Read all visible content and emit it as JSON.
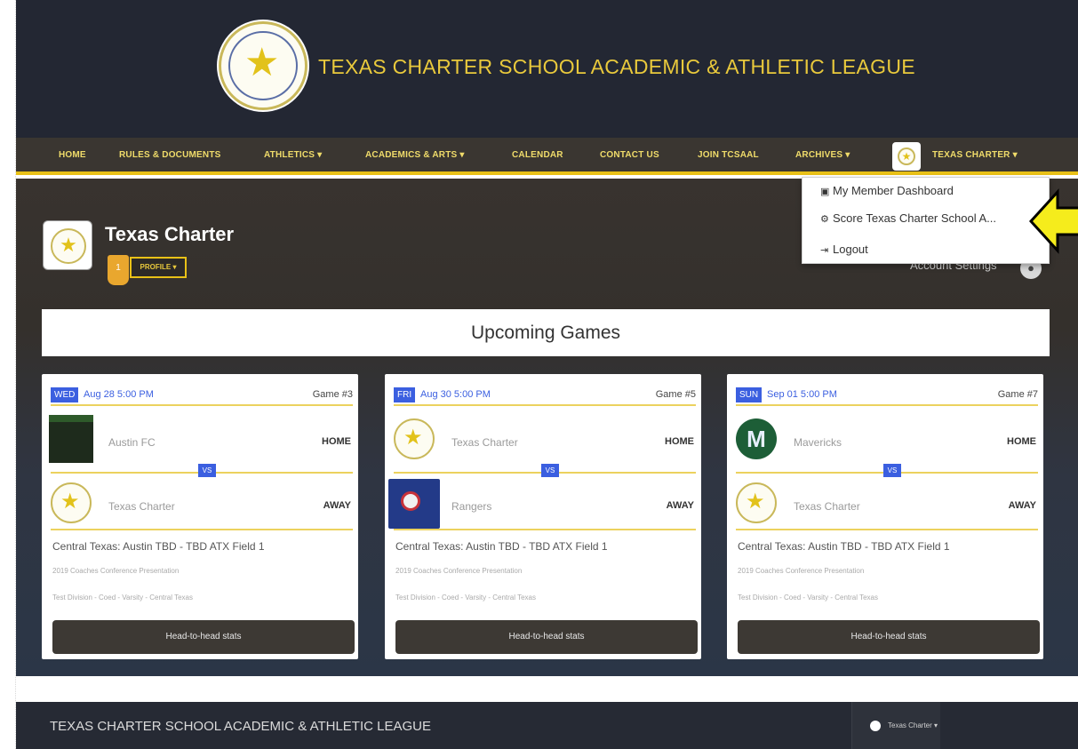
{
  "site": {
    "title": "TEXAS CHARTER SCHOOL ACADEMIC & ATHLETIC LEAGUE"
  },
  "nav": {
    "home": "HOME",
    "rules": "RULES & DOCUMENTS",
    "athletics": "ATHLETICS ▾",
    "academics": "ACADEMICS & ARTS ▾",
    "calendar": "CALENDAR",
    "contact": "CONTACT US",
    "join": "JOIN TCSAAL",
    "archives": "ARCHIVES ▾",
    "user": "TEXAS CHARTER ▾"
  },
  "dropdown": {
    "dashboard": "My Member Dashboard",
    "score": "Score Texas Charter School A...",
    "logout": "Logout"
  },
  "profile": {
    "name": "Texas Charter",
    "badge": "1",
    "button": "PROFILE ▾",
    "account_settings": "Account Settings"
  },
  "upcoming": {
    "title": "Upcoming Games"
  },
  "games": [
    {
      "day": "WED",
      "date": "Aug 28 5:00 PM",
      "game_no": "Game #3",
      "home_team": "Austin FC",
      "home_label": "HOME",
      "away_team": "Texas Charter",
      "away_label": "AWAY",
      "vs": "VS",
      "venue": "Central Texas: Austin TBD - TBD ATX Field 1",
      "event": "2019 Coaches Conference Presentation",
      "division": "Test Division - Coed - Varsity - Central Texas",
      "button": "Head-to-head stats"
    },
    {
      "day": "FRI",
      "date": "Aug 30 5:00 PM",
      "game_no": "Game #5",
      "home_team": "Texas Charter",
      "home_label": "HOME",
      "away_team": "Rangers",
      "away_label": "AWAY",
      "vs": "VS",
      "venue": "Central Texas: Austin TBD - TBD ATX Field 1",
      "event": "2019 Coaches Conference Presentation",
      "division": "Test Division - Coed - Varsity - Central Texas",
      "button": "Head-to-head stats"
    },
    {
      "day": "SUN",
      "date": "Sep 01 5:00 PM",
      "game_no": "Game #7",
      "home_team": "Mavericks",
      "home_label": "HOME",
      "away_team": "Texas Charter",
      "away_label": "AWAY",
      "vs": "VS",
      "venue": "Central Texas: Austin TBD - TBD ATX Field 1",
      "event": "2019 Coaches Conference Presentation",
      "division": "Test Division - Coed - Varsity - Central Texas",
      "button": "Head-to-head stats"
    }
  ],
  "footer": {
    "title": "TEXAS CHARTER SCHOOL ACADEMIC & ATHLETIC LEAGUE",
    "user": "Texas Charter ▾"
  },
  "colors": {
    "header_bg": "#232733",
    "nav_bg": "#3a3631",
    "accent": "#e9c117",
    "link_blue": "#3b5fe0",
    "arrow": "#f5ec1c"
  },
  "icons": {
    "dashboard": "dashboard-icon",
    "score": "gear-icon",
    "logout": "logout-icon",
    "account": "user-icon",
    "pointer": "arrow-left-icon"
  }
}
